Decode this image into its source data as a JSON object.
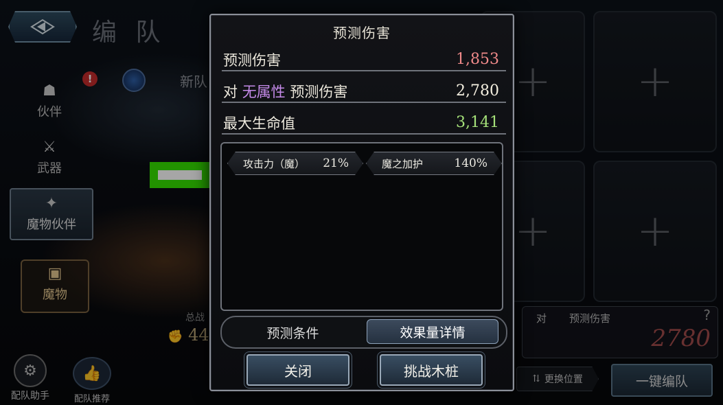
{
  "header": {
    "title": "编 队"
  },
  "sidebar": {
    "items": [
      {
        "label": "伙伴",
        "icon": "helmet-icon"
      },
      {
        "label": "武器",
        "icon": "crossed-swords-icon"
      },
      {
        "label": "魔物伙伴",
        "icon": "dragon-icon"
      },
      {
        "label": "魔物",
        "icon": "tv-icon"
      }
    ]
  },
  "team": {
    "name": "新队",
    "total_label": "总战",
    "total_value": "44"
  },
  "modal": {
    "title": "预测伤害",
    "stats": [
      {
        "label": "预测伤害",
        "value": "1,853",
        "color": "#f08a8a"
      },
      {
        "label_prefix": "对 ",
        "label_attr": "无属性",
        "label_suffix": " 预测伤害",
        "value": "2,780",
        "color": "#f4efe0"
      },
      {
        "label": "最大生命值",
        "value": "3,141",
        "color": "#a6e27a"
      }
    ],
    "effects": [
      {
        "name": "攻击力（魔）",
        "percent": "21%"
      },
      {
        "name": "魔之加护",
        "percent": "140%"
      }
    ],
    "tabs": [
      {
        "label": "预测条件",
        "active": false
      },
      {
        "label": "效果量详情",
        "active": true
      }
    ],
    "buttons": {
      "close": "关闭",
      "challenge": "挑战木桩"
    }
  },
  "right_panel": {
    "pred_label_1": "对",
    "pred_label_2": "预测伤害",
    "help": "?",
    "pred_value": "2780",
    "swap_label": "更换位置",
    "quick_label": "一键编队"
  },
  "bottom": {
    "helper": "配队助手",
    "recommend": "配队推荐"
  }
}
